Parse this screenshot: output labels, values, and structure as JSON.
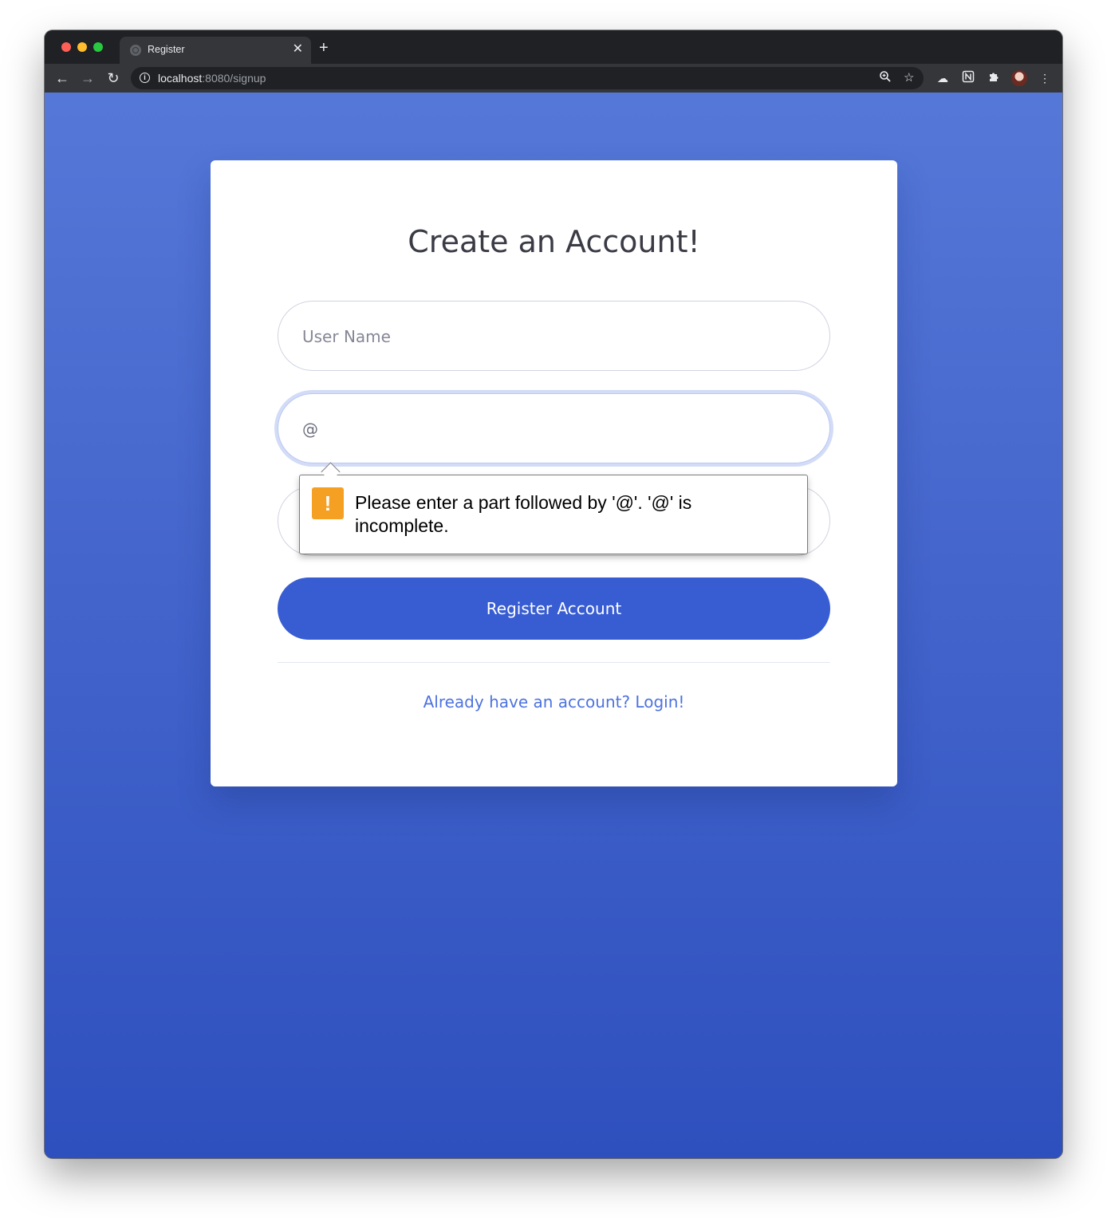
{
  "browser": {
    "tab_title": "Register",
    "tab_close": "✕",
    "new_tab": "+",
    "url_host": "localhost",
    "url_rest": ":8080/signup",
    "icons": [
      "back-arrow-icon",
      "forward-arrow-icon",
      "reload-icon",
      "info-icon",
      "zoom-icon",
      "star-icon",
      "cloud-extension-icon",
      "notion-extension-icon",
      "puzzle-extensions-icon",
      "profile-avatar",
      "more-vert-icon"
    ]
  },
  "page": {
    "heading": "Create an Account!",
    "username_placeholder": "User Name",
    "email_value": "@",
    "register_button": "Register Account",
    "login_link": "Already have an account? Login!",
    "validation_message": "Please enter a part followed by '@'. '@' is incomplete.",
    "warning_glyph": "!"
  },
  "colors": {
    "background_top": "#5578d8",
    "background_bottom": "#2e50be",
    "button": "#385dd2",
    "link": "#4e73df",
    "warning": "#f5a023"
  }
}
